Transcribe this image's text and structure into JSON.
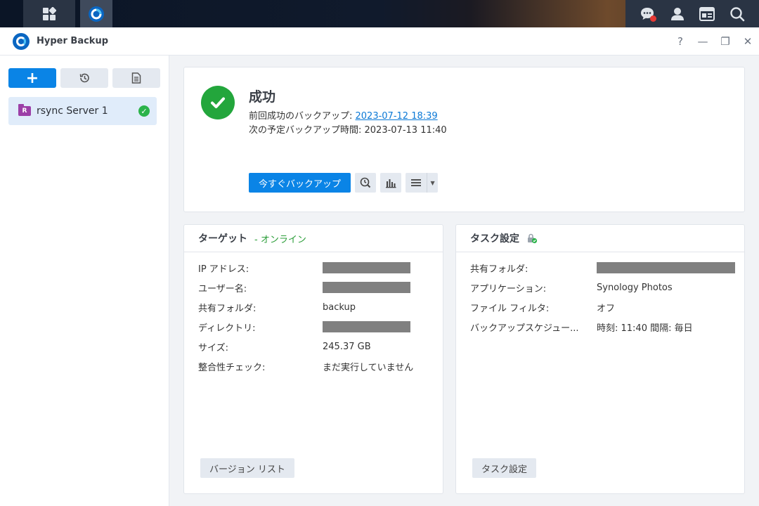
{
  "window": {
    "title": "Hyper Backup",
    "controls": [
      "?",
      "—",
      "❐",
      "✕"
    ]
  },
  "sidebar": {
    "add_label": "+",
    "tasks": [
      {
        "label": "rsync Server 1",
        "icon_text": "R",
        "status": "success"
      }
    ]
  },
  "status": {
    "title": "成功",
    "last_backup_label": "前回成功のバックアップ: ",
    "last_backup_value": "2023-07-12 18:39",
    "next_backup_label": "次の予定バックアップ時間: ",
    "next_backup_value": "2023-07-13 11:40",
    "backup_now_label": "今すぐバックアップ"
  },
  "target": {
    "title": "ターゲット",
    "online_label": "- オンライン",
    "rows": [
      {
        "key": "IP アドレス:",
        "value": "",
        "redacted": true
      },
      {
        "key": "ユーザー名:",
        "value": "",
        "redacted": true
      },
      {
        "key": "共有フォルダ:",
        "value": "backup",
        "redacted": false
      },
      {
        "key": "ディレクトリ:",
        "value": "",
        "redacted": true
      },
      {
        "key": "サイズ:",
        "value": "245.37 GB",
        "redacted": false
      },
      {
        "key": "整合性チェック:",
        "value": "まだ実行していません",
        "redacted": false
      }
    ],
    "footer_button": "バージョン リスト"
  },
  "task_settings": {
    "title": "タスク設定",
    "rows": [
      {
        "key": "共有フォルダ:",
        "value": "",
        "redacted": true
      },
      {
        "key": "アプリケーション:",
        "value": "Synology Photos",
        "redacted": false
      },
      {
        "key": "ファイル フィルタ:",
        "value": "オフ",
        "redacted": false
      },
      {
        "key": "バックアップスケジュー...",
        "value": "時刻: 11:40 間隔: 毎日",
        "redacted": false
      }
    ],
    "footer_button": "タスク設定"
  },
  "colors": {
    "accent": "#0a84e6",
    "success": "#23a63c",
    "online": "#2a9d38",
    "task_icon": "#9c3fa7"
  }
}
